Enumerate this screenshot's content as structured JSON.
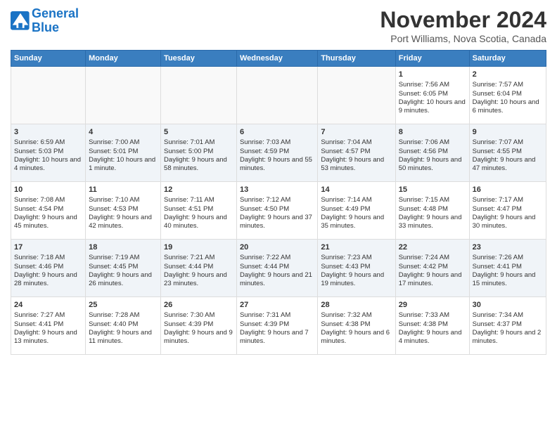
{
  "logo": {
    "line1": "General",
    "line2": "Blue"
  },
  "title": "November 2024",
  "subtitle": "Port Williams, Nova Scotia, Canada",
  "days_header": [
    "Sunday",
    "Monday",
    "Tuesday",
    "Wednesday",
    "Thursday",
    "Friday",
    "Saturday"
  ],
  "weeks": [
    [
      {
        "day": "",
        "info": ""
      },
      {
        "day": "",
        "info": ""
      },
      {
        "day": "",
        "info": ""
      },
      {
        "day": "",
        "info": ""
      },
      {
        "day": "",
        "info": ""
      },
      {
        "day": "1",
        "info": "Sunrise: 7:56 AM\nSunset: 6:05 PM\nDaylight: 10 hours and 9 minutes."
      },
      {
        "day": "2",
        "info": "Sunrise: 7:57 AM\nSunset: 6:04 PM\nDaylight: 10 hours and 6 minutes."
      }
    ],
    [
      {
        "day": "3",
        "info": "Sunrise: 6:59 AM\nSunset: 5:03 PM\nDaylight: 10 hours and 4 minutes."
      },
      {
        "day": "4",
        "info": "Sunrise: 7:00 AM\nSunset: 5:01 PM\nDaylight: 10 hours and 1 minute."
      },
      {
        "day": "5",
        "info": "Sunrise: 7:01 AM\nSunset: 5:00 PM\nDaylight: 9 hours and 58 minutes."
      },
      {
        "day": "6",
        "info": "Sunrise: 7:03 AM\nSunset: 4:59 PM\nDaylight: 9 hours and 55 minutes."
      },
      {
        "day": "7",
        "info": "Sunrise: 7:04 AM\nSunset: 4:57 PM\nDaylight: 9 hours and 53 minutes."
      },
      {
        "day": "8",
        "info": "Sunrise: 7:06 AM\nSunset: 4:56 PM\nDaylight: 9 hours and 50 minutes."
      },
      {
        "day": "9",
        "info": "Sunrise: 7:07 AM\nSunset: 4:55 PM\nDaylight: 9 hours and 47 minutes."
      }
    ],
    [
      {
        "day": "10",
        "info": "Sunrise: 7:08 AM\nSunset: 4:54 PM\nDaylight: 9 hours and 45 minutes."
      },
      {
        "day": "11",
        "info": "Sunrise: 7:10 AM\nSunset: 4:53 PM\nDaylight: 9 hours and 42 minutes."
      },
      {
        "day": "12",
        "info": "Sunrise: 7:11 AM\nSunset: 4:51 PM\nDaylight: 9 hours and 40 minutes."
      },
      {
        "day": "13",
        "info": "Sunrise: 7:12 AM\nSunset: 4:50 PM\nDaylight: 9 hours and 37 minutes."
      },
      {
        "day": "14",
        "info": "Sunrise: 7:14 AM\nSunset: 4:49 PM\nDaylight: 9 hours and 35 minutes."
      },
      {
        "day": "15",
        "info": "Sunrise: 7:15 AM\nSunset: 4:48 PM\nDaylight: 9 hours and 33 minutes."
      },
      {
        "day": "16",
        "info": "Sunrise: 7:17 AM\nSunset: 4:47 PM\nDaylight: 9 hours and 30 minutes."
      }
    ],
    [
      {
        "day": "17",
        "info": "Sunrise: 7:18 AM\nSunset: 4:46 PM\nDaylight: 9 hours and 28 minutes."
      },
      {
        "day": "18",
        "info": "Sunrise: 7:19 AM\nSunset: 4:45 PM\nDaylight: 9 hours and 26 minutes."
      },
      {
        "day": "19",
        "info": "Sunrise: 7:21 AM\nSunset: 4:44 PM\nDaylight: 9 hours and 23 minutes."
      },
      {
        "day": "20",
        "info": "Sunrise: 7:22 AM\nSunset: 4:44 PM\nDaylight: 9 hours and 21 minutes."
      },
      {
        "day": "21",
        "info": "Sunrise: 7:23 AM\nSunset: 4:43 PM\nDaylight: 9 hours and 19 minutes."
      },
      {
        "day": "22",
        "info": "Sunrise: 7:24 AM\nSunset: 4:42 PM\nDaylight: 9 hours and 17 minutes."
      },
      {
        "day": "23",
        "info": "Sunrise: 7:26 AM\nSunset: 4:41 PM\nDaylight: 9 hours and 15 minutes."
      }
    ],
    [
      {
        "day": "24",
        "info": "Sunrise: 7:27 AM\nSunset: 4:41 PM\nDaylight: 9 hours and 13 minutes."
      },
      {
        "day": "25",
        "info": "Sunrise: 7:28 AM\nSunset: 4:40 PM\nDaylight: 9 hours and 11 minutes."
      },
      {
        "day": "26",
        "info": "Sunrise: 7:30 AM\nSunset: 4:39 PM\nDaylight: 9 hours and 9 minutes."
      },
      {
        "day": "27",
        "info": "Sunrise: 7:31 AM\nSunset: 4:39 PM\nDaylight: 9 hours and 7 minutes."
      },
      {
        "day": "28",
        "info": "Sunrise: 7:32 AM\nSunset: 4:38 PM\nDaylight: 9 hours and 6 minutes."
      },
      {
        "day": "29",
        "info": "Sunrise: 7:33 AM\nSunset: 4:38 PM\nDaylight: 9 hours and 4 minutes."
      },
      {
        "day": "30",
        "info": "Sunrise: 7:34 AM\nSunset: 4:37 PM\nDaylight: 9 hours and 2 minutes."
      }
    ]
  ]
}
